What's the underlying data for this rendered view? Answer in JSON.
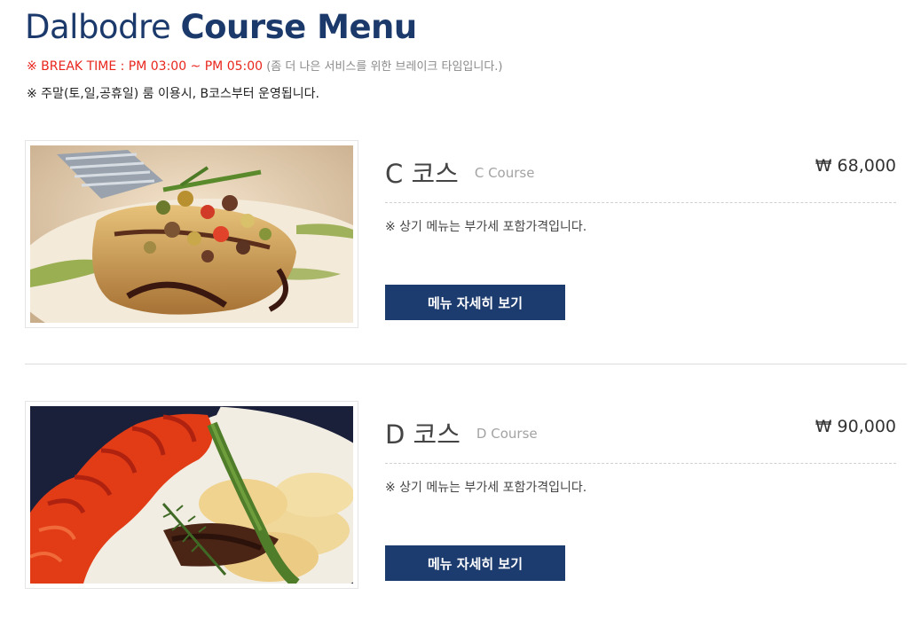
{
  "header": {
    "title_light": "Dalbodre ",
    "title_bold": "Course Menu",
    "notice_break": "※ BREAK TIME : PM 03:00 ~ PM 05:00",
    "notice_break_sub": " (좀 더 나은 서비스를 위한 브레이크 타임입니다.)",
    "notice_weekend": "※ 주말(토,일,공휴일) 룸 이용시, B코스부터 운영됩니다."
  },
  "courses": [
    {
      "name_ko": "C 코스",
      "name_en": "C Course",
      "price": "₩ 68,000",
      "vat_note": "※ 상기 메뉴는 부가세 포함가격입니다.",
      "button_label": "메뉴 자세히 보기"
    },
    {
      "name_ko": "D 코스",
      "name_en": "D Course",
      "price": "₩ 90,000",
      "vat_note": "※ 상기 메뉴는 부가세 포함가격입니다.",
      "button_label": "메뉴 자세히 보기"
    }
  ],
  "colors": {
    "brand": "#1c3b6e",
    "notice_red": "#e8261d"
  }
}
